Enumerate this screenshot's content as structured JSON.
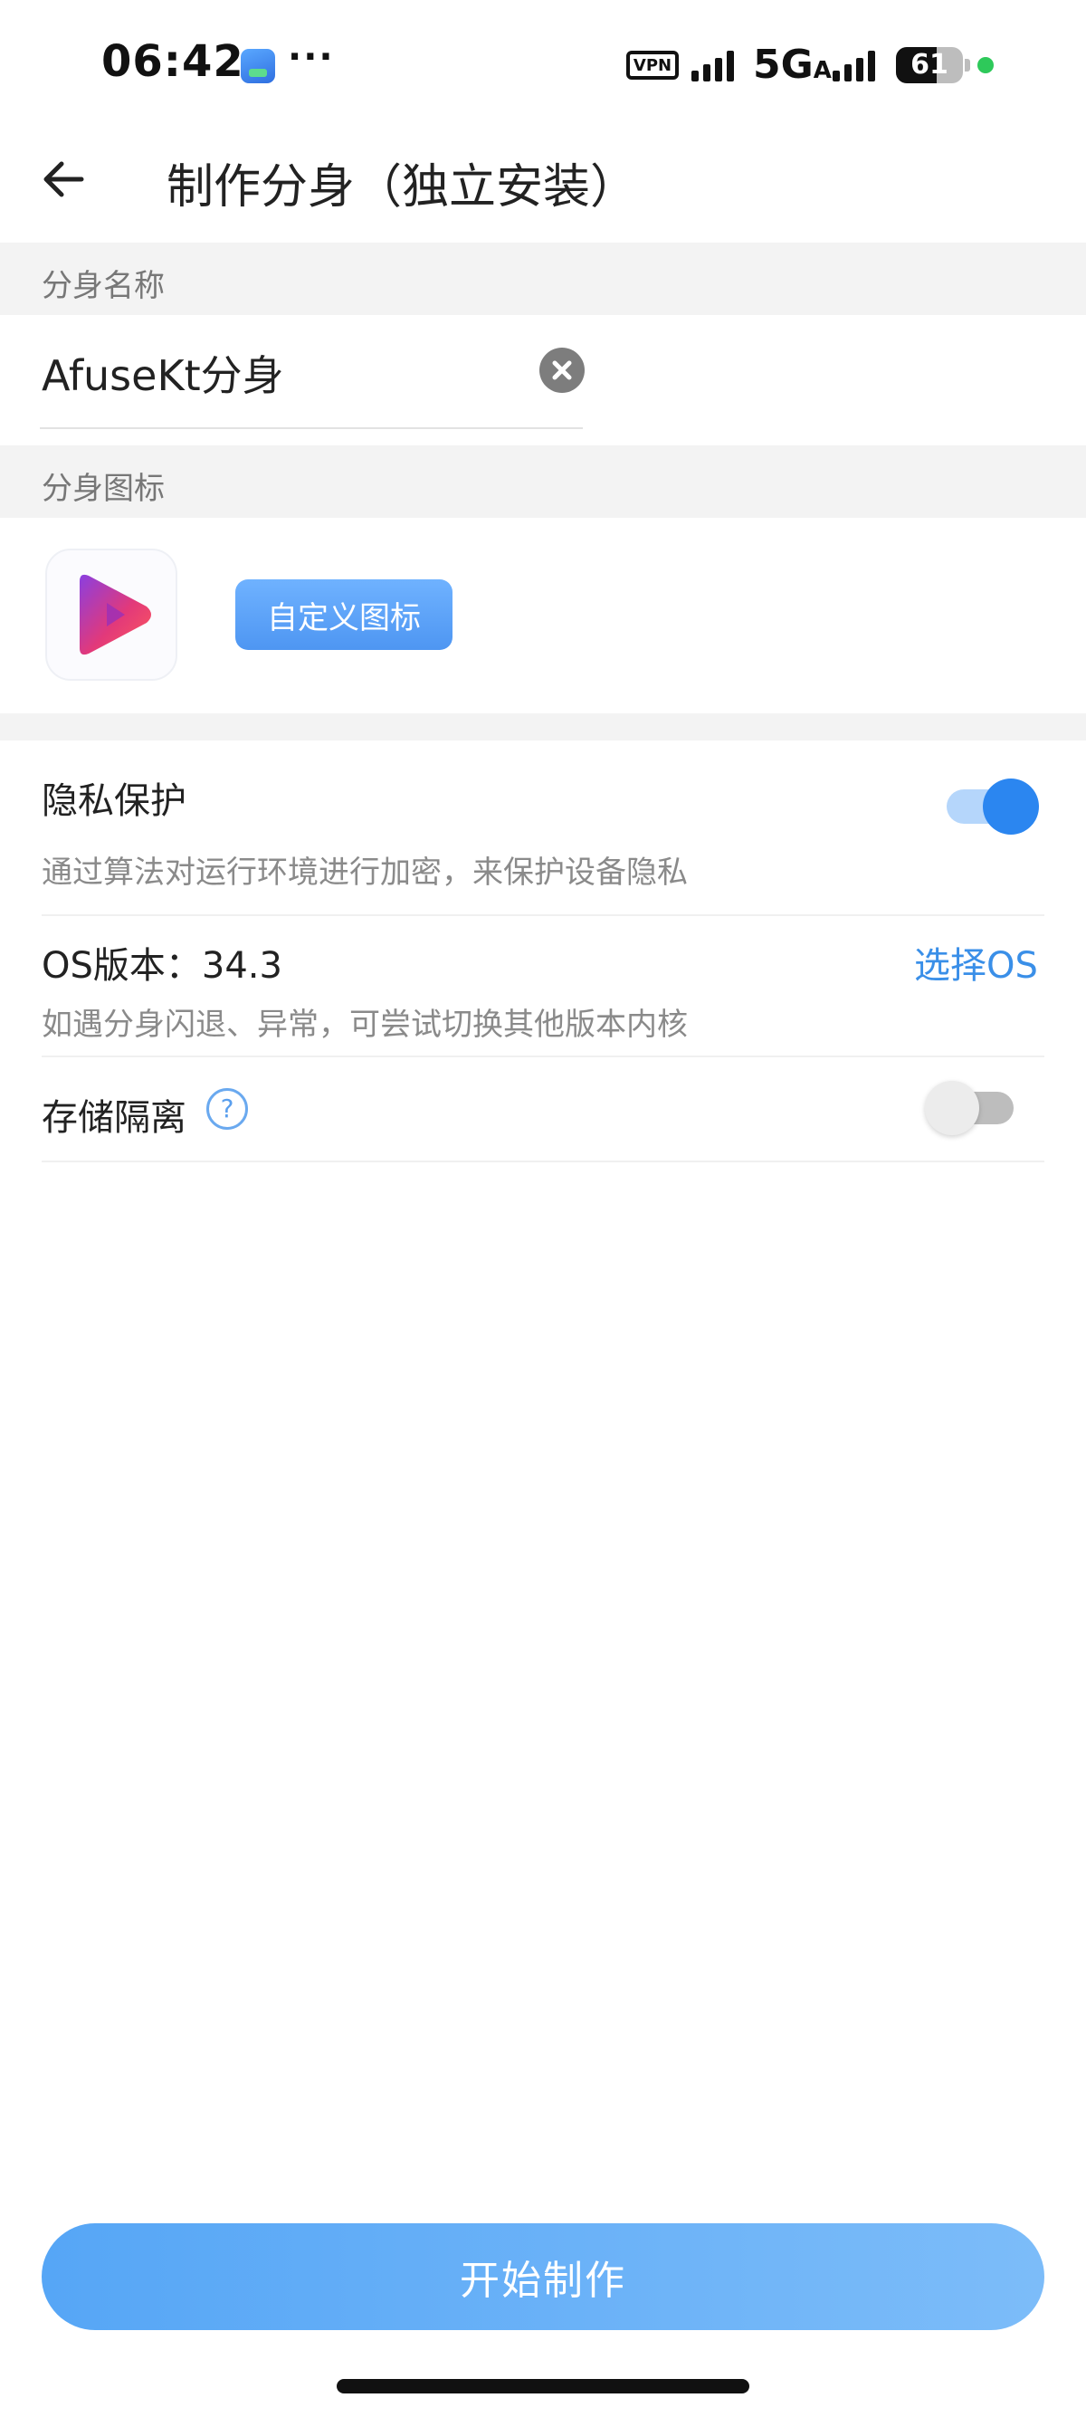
{
  "status_bar": {
    "time": "06:42",
    "more": "···",
    "vpn": "VPN",
    "network": "5G",
    "network_sub": "A",
    "battery": "61",
    "battery_level": 0.61
  },
  "header": {
    "back_icon": "arrow-left-icon",
    "title": "制作分身（独立安装）"
  },
  "name_section": {
    "label": "分身名称",
    "value": "AfuseKt分身"
  },
  "icon_section": {
    "label": "分身图标",
    "custom_button": "自定义图标"
  },
  "settings": {
    "privacy": {
      "title": "隐私保护",
      "description": "通过算法对运行环境进行加密，来保护设备隐私",
      "enabled": true
    },
    "os": {
      "title": "OS版本：34.3",
      "description": "如遇分身闪退、异常，可尝试切换其他版本内核",
      "select_label": "选择OS"
    },
    "storage": {
      "title": "存储隔离",
      "help": "?",
      "enabled": false
    }
  },
  "colors": {
    "accent": "#2b86f0",
    "link": "#3a8fe8",
    "button_gradient_start": "#56a6f6",
    "button_gradient_end": "#7cbcf9"
  },
  "footer": {
    "start_button": "开始制作"
  }
}
